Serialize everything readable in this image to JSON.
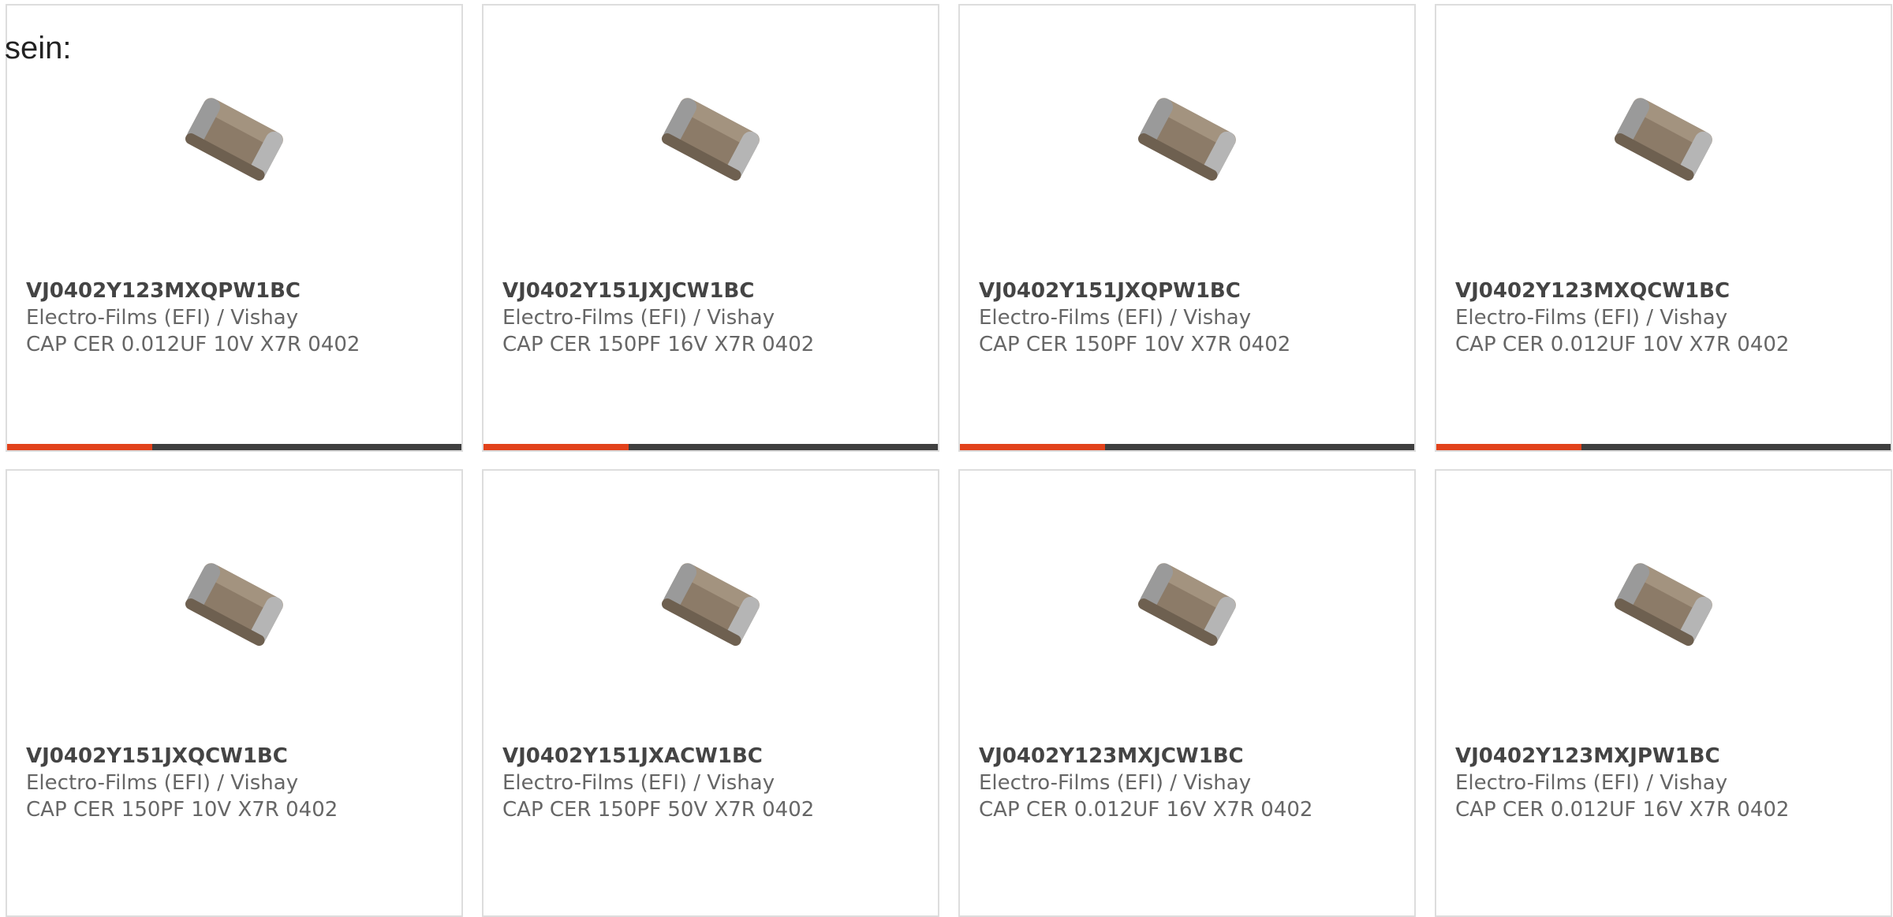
{
  "intro_text": "sein:",
  "accent_color": "#e2421b",
  "bar_color": "#3f3f3f",
  "products": [
    {
      "part": "VJ0402Y123MXQPW1BC",
      "maker": "Electro-Films (EFI) / Vishay",
      "desc": "CAP CER 0.012UF 10V X7R 0402",
      "image": "ceramic-capacitor-chip-icon"
    },
    {
      "part": "VJ0402Y151JXJCW1BC",
      "maker": "Electro-Films (EFI) / Vishay",
      "desc": "CAP CER 150PF 16V X7R 0402",
      "image": "ceramic-capacitor-chip-icon"
    },
    {
      "part": "VJ0402Y151JXQPW1BC",
      "maker": "Electro-Films (EFI) / Vishay",
      "desc": "CAP CER 150PF 10V X7R 0402",
      "image": "ceramic-capacitor-chip-icon"
    },
    {
      "part": "VJ0402Y123MXQCW1BC",
      "maker": "Electro-Films (EFI) / Vishay",
      "desc": "CAP CER 0.012UF 10V X7R 0402",
      "image": "ceramic-capacitor-chip-icon"
    },
    {
      "part": "VJ0402Y151JXQCW1BC",
      "maker": "Electro-Films (EFI) / Vishay",
      "desc": "CAP CER 150PF 10V X7R 0402",
      "image": "ceramic-capacitor-chip-icon"
    },
    {
      "part": "VJ0402Y151JXACW1BC",
      "maker": "Electro-Films (EFI) / Vishay",
      "desc": "CAP CER 150PF 50V X7R 0402",
      "image": "ceramic-capacitor-chip-icon"
    },
    {
      "part": "VJ0402Y123MXJCW1BC",
      "maker": "Electro-Films (EFI) / Vishay",
      "desc": "CAP CER 0.012UF 16V X7R 0402",
      "image": "ceramic-capacitor-chip-icon"
    },
    {
      "part": "VJ0402Y123MXJPW1BC",
      "maker": "Electro-Films (EFI) / Vishay",
      "desc": "CAP CER 0.012UF 16V X7R 0402",
      "image": "ceramic-capacitor-chip-icon"
    }
  ]
}
